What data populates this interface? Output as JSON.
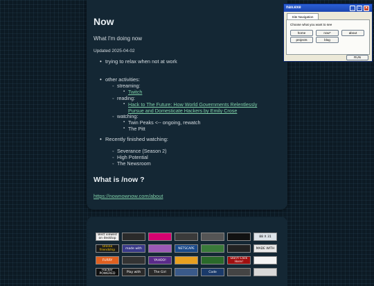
{
  "page": {
    "title": "Now",
    "intro": "What I'm doing now",
    "updated": "Updated 2025-04-02",
    "items": {
      "relax": "trying to relax when not at work",
      "other": "other activities:"
    },
    "streaming_label": "streaming:",
    "streaming_link": "Twitch",
    "reading_label": "reading:",
    "reading_link": "Hack to The Future: How World Governments Relentlessly Pursue and Domesticate Hackers by Emily Crose",
    "watching_label": "watching:",
    "watching": [
      "Twin Peaks <-- ongoing, rewatch",
      "The Pitt"
    ],
    "recent_label": "Recently finished watching:",
    "recent": [
      "Severance (Season 2)",
      "High Potential",
      "The Newsroom"
    ],
    "what_is_now": "What is /now ?",
    "now_link": "https://nownownow.com/about"
  },
  "window": {
    "title": "nav.exe",
    "tab": "Site Navigation",
    "prompt": "Choose what you want to see",
    "buttons": [
      "home",
      "now*",
      "about",
      "projects",
      "blog"
    ],
    "run": "RUN",
    "controls": [
      "_",
      "□",
      "×"
    ]
  },
  "badges": [
    {
      "text": "Best viewed on desktop",
      "bg": "#f0f0f0",
      "fg": "#000000"
    },
    {
      "text": "",
      "bg": "#2a2a2a",
      "fg": "#ffffff"
    },
    {
      "text": "",
      "bg": "#d60270",
      "fg": "#ffffff"
    },
    {
      "text": "",
      "bg": "#3a3a3a",
      "fg": "#ffffff"
    },
    {
      "text": "",
      "bg": "#555555",
      "fg": "#ffffff"
    },
    {
      "text": "",
      "bg": "#111111",
      "fg": "#ffffff"
    },
    {
      "text": "88 X 31",
      "bg": "#dde4ea",
      "fg": "#000000"
    },
    {
      "text": "Online friendship",
      "bg": "#1a1a1a",
      "fg": "#ffcc00"
    },
    {
      "text": "made with",
      "bg": "#3a3a8a",
      "fg": "#ffffff"
    },
    {
      "text": "",
      "bg": "#9b59b6",
      "fg": "#ffffff"
    },
    {
      "text": "NETSCAPE",
      "bg": "#1a4a8a",
      "fg": "#ffffff"
    },
    {
      "text": "",
      "bg": "#3a7a3a",
      "fg": "#ffffff"
    },
    {
      "text": "",
      "bg": "#222222",
      "fg": "#ffffff"
    },
    {
      "text": "MADE WITH",
      "bg": "#e8e8e8",
      "fg": "#000000"
    },
    {
      "text": "FURRY",
      "bg": "#e06020",
      "fg": "#ffffff"
    },
    {
      "text": "",
      "bg": "#333333",
      "fg": "#ffffff"
    },
    {
      "text": "YAHOO!",
      "bg": "#5a2a8a",
      "fg": "#ffffff"
    },
    {
      "text": "",
      "bg": "#e8a020",
      "fg": "#000000"
    },
    {
      "text": "",
      "bg": "#2a6a2a",
      "fg": "#ffffff"
    },
    {
      "text": "Don't Click Here!",
      "bg": "#a01010",
      "fg": "#ffffff"
    },
    {
      "text": "",
      "bg": "#f4f4f4",
      "fg": "#000000"
    },
    {
      "text": "Hacker POWERED",
      "bg": "#101010",
      "fg": "#ffffff"
    },
    {
      "text": "Play with",
      "bg": "#2a2a2a",
      "fg": "#ffffff"
    },
    {
      "text": "The Girl",
      "bg": "#2a2a2a",
      "fg": "#ffffff"
    },
    {
      "text": "",
      "bg": "#3a5a8a",
      "fg": "#ffffff"
    },
    {
      "text": "Code",
      "bg": "#1a3a6a",
      "fg": "#ffffff"
    },
    {
      "text": "",
      "bg": "#444444",
      "fg": "#ffffff"
    },
    {
      "text": "",
      "bg": "#d8d8d8",
      "fg": "#000000"
    }
  ]
}
